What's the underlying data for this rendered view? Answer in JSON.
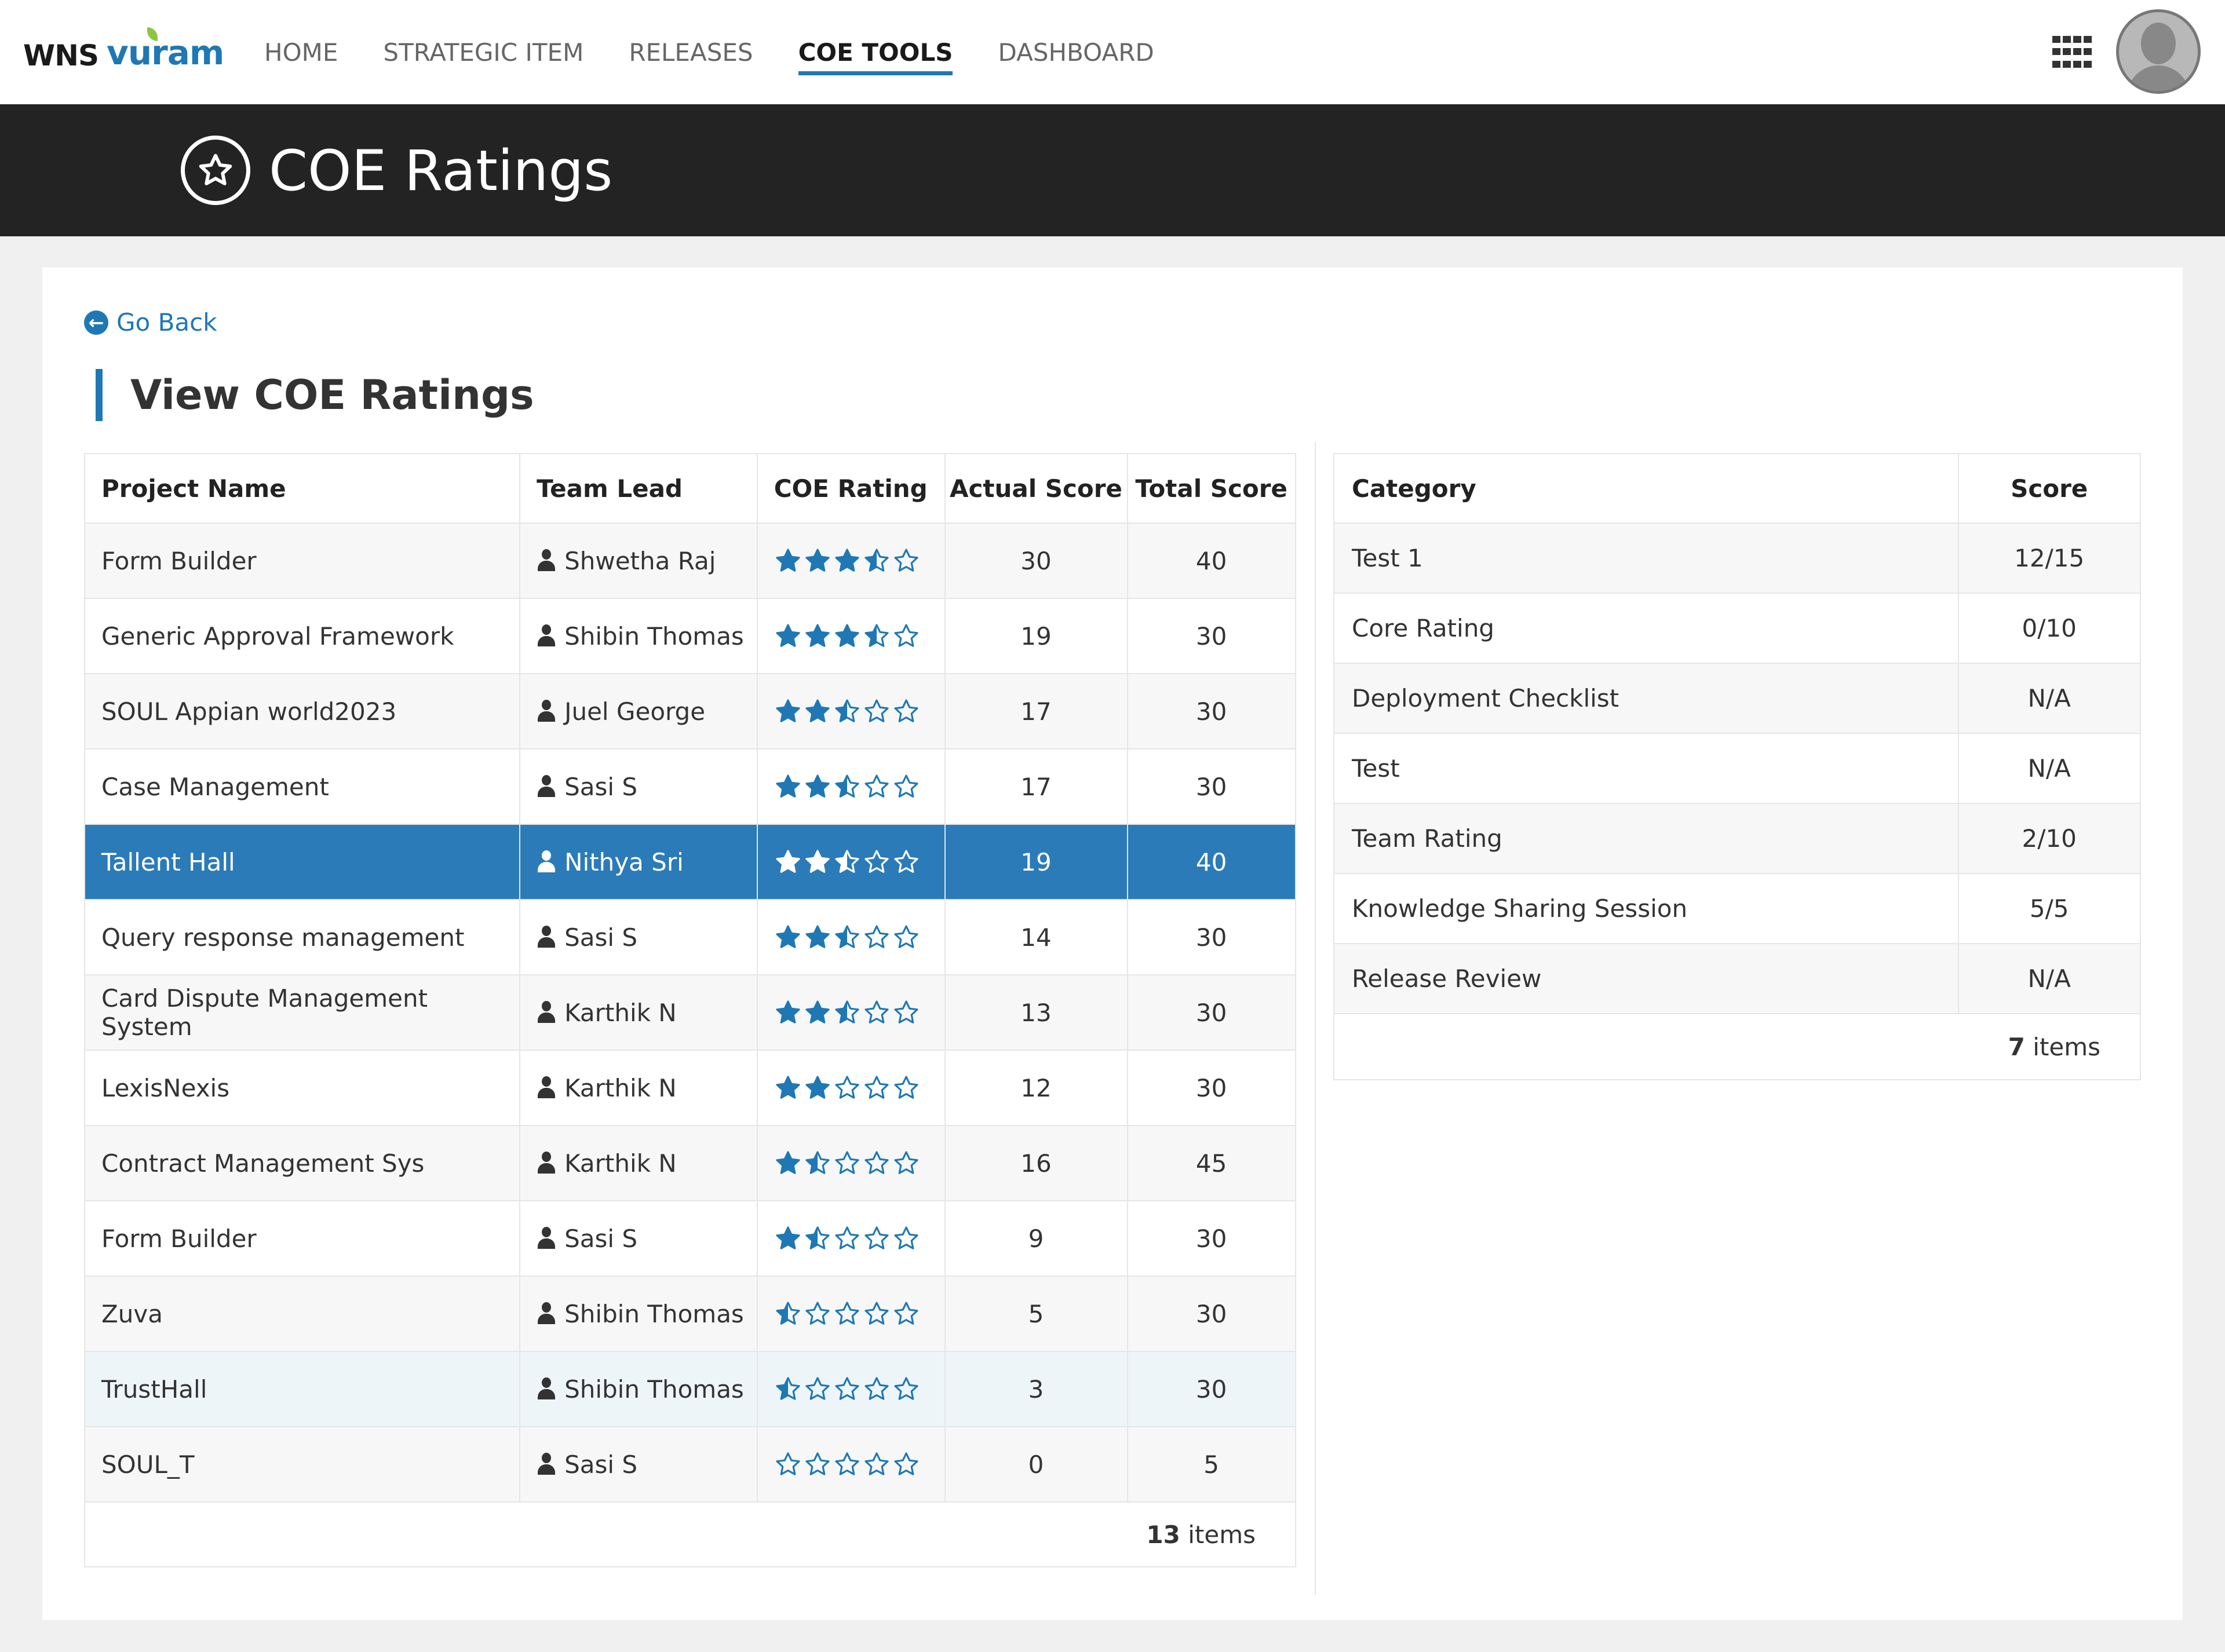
{
  "brand": {
    "wns": "WNS",
    "vuram": "vuram"
  },
  "nav": [
    "HOME",
    "STRATEGIC ITEM",
    "RELEASES",
    "COE TOOLS",
    "DASHBOARD"
  ],
  "active_nav": "COE TOOLS",
  "hero": {
    "title": "COE Ratings"
  },
  "go_back": "Go Back",
  "section_title": "View COE Ratings",
  "accent_color": "#1f78b4",
  "projects": {
    "headers": [
      "Project Name",
      "Team Lead",
      "COE Rating",
      "Actual Score",
      "Total Score"
    ],
    "rows": [
      {
        "name": "Form Builder",
        "lead": "Shwetha Raj",
        "rating": 3.5,
        "actual": "30",
        "total": "40"
      },
      {
        "name": "Generic Approval Framework",
        "lead": "Shibin Thomas",
        "rating": 3.5,
        "actual": "19",
        "total": "30"
      },
      {
        "name": "SOUL Appian world2023",
        "lead": "Juel George",
        "rating": 2.5,
        "actual": "17",
        "total": "30"
      },
      {
        "name": "Case Management",
        "lead": "Sasi S",
        "rating": 2.5,
        "actual": "17",
        "total": "30"
      },
      {
        "name": "Tallent Hall",
        "lead": "Nithya Sri",
        "rating": 2.5,
        "actual": "19",
        "total": "40"
      },
      {
        "name": "Query response management",
        "lead": "Sasi S",
        "rating": 2.5,
        "actual": "14",
        "total": "30"
      },
      {
        "name": "Card Dispute Management System",
        "lead": "Karthik N",
        "rating": 2.5,
        "actual": "13",
        "total": "30"
      },
      {
        "name": "LexisNexis",
        "lead": "Karthik N",
        "rating": 2,
        "actual": "12",
        "total": "30"
      },
      {
        "name": "Contract Management Sys",
        "lead": "Karthik N",
        "rating": 1.5,
        "actual": "16",
        "total": "45"
      },
      {
        "name": "Form Builder",
        "lead": "Sasi S",
        "rating": 1.5,
        "actual": "9",
        "total": "30"
      },
      {
        "name": "Zuva",
        "lead": "Shibin Thomas",
        "rating": 0.5,
        "actual": "5",
        "total": "30"
      },
      {
        "name": "TrustHall",
        "lead": "Shibin Thomas",
        "rating": 0.5,
        "actual": "3",
        "total": "30"
      },
      {
        "name": "SOUL_T",
        "lead": "Sasi S",
        "rating": 0,
        "actual": "0",
        "total": "5"
      }
    ],
    "selected_index": 4,
    "hover_index": 11,
    "count": "13",
    "count_label": "items"
  },
  "categories": {
    "headers": [
      "Category",
      "Score"
    ],
    "rows": [
      {
        "category": "Test  1",
        "score": "12/15"
      },
      {
        "category": "Core Rating",
        "score": "0/10"
      },
      {
        "category": "Deployment Checklist",
        "score": "N/A"
      },
      {
        "category": "Test",
        "score": "N/A"
      },
      {
        "category": "Team Rating",
        "score": "2/10"
      },
      {
        "category": "Knowledge Sharing Session",
        "score": "5/5"
      },
      {
        "category": "Release Review",
        "score": "N/A"
      }
    ],
    "count": "7",
    "count_label": "items"
  }
}
